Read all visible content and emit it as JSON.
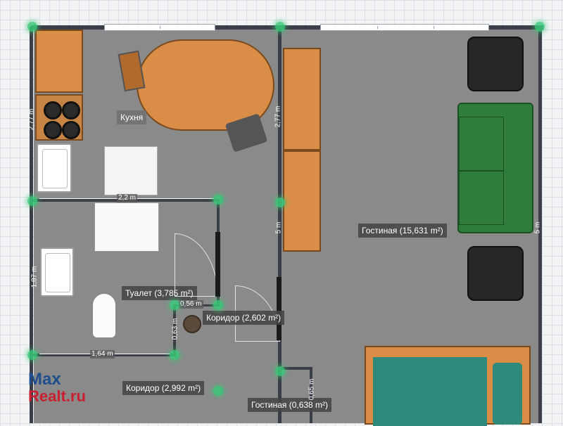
{
  "rooms": {
    "kitchen": "Кухня",
    "toilet": "Туалет (3,785 m²)",
    "corridor_main": "Коридор (2,602 m²)",
    "living": "Гостиная (15,631 m²)",
    "corridor_lower": "Коридор (2,992 m²)",
    "living_small": "Гостиная (0,638 m²)"
  },
  "dimensions": {
    "kitchen_width": "2,2 m",
    "kitchen_height": "2,77 m",
    "living_left": "2,77 m",
    "corridor_tall": "5 m",
    "living_height": "5 m",
    "toilet_height": "1,87 m",
    "toilet_width": "1,64 m",
    "small_w": "0,56 m",
    "small_h": "0,63 m",
    "lower_w": "0,65 m"
  },
  "watermark": {
    "line1": "Max",
    "line2": "Realt.ru"
  },
  "colors": {
    "floor": "#8a8a8a",
    "wall": "#3a3f47",
    "node": "#3ac878",
    "wood": "#d98d47",
    "sofa": "#2e7d3a",
    "bed": "#2e8a7a",
    "logo_blue": "#1f4e8c",
    "logo_red": "#c8202f"
  }
}
